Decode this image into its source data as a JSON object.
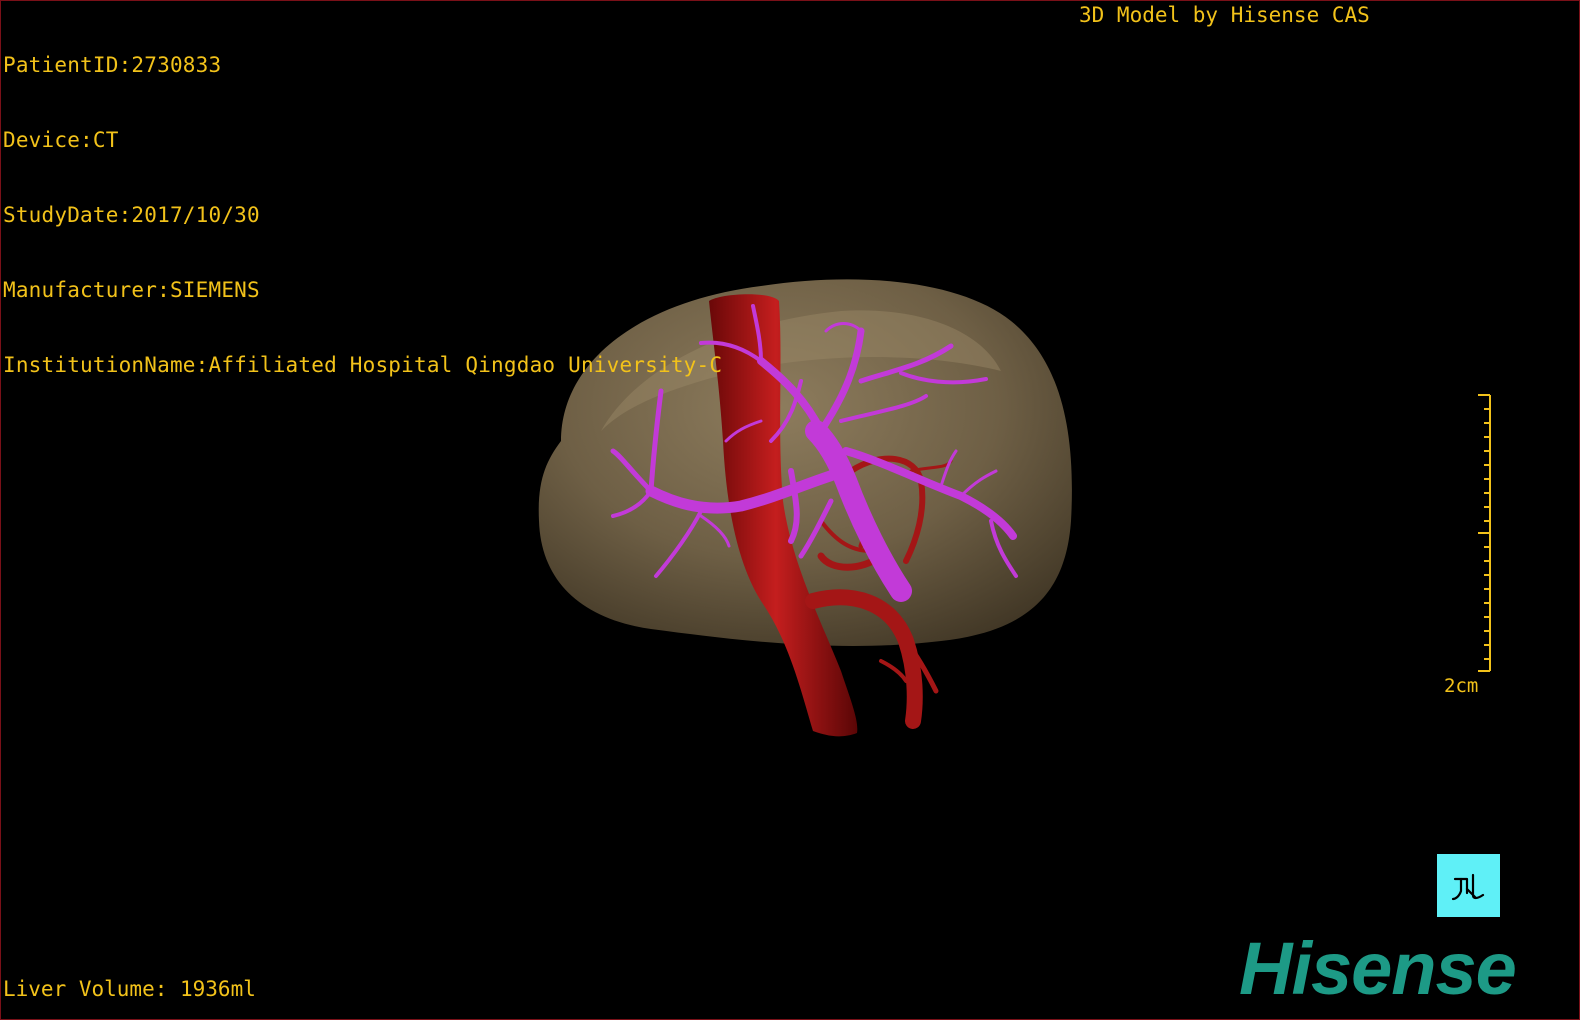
{
  "header": {
    "patient_id": "PatientID:2730833",
    "device": "Device:CT",
    "study_date": "StudyDate:2017/10/30",
    "manufacturer": "Manufacturer:SIEMENS",
    "institution": "InstitutionName:Affiliated Hospital Qingdao University-C",
    "credit": "3D Model by Hisense CAS"
  },
  "footer": {
    "liver_volume": "Liver Volume: 1936ml"
  },
  "scale": {
    "label": "2cm"
  },
  "orientation": {
    "icon": "orientation-cube-icon"
  },
  "brand": {
    "logo_text": "Hisense"
  },
  "colors": {
    "text": "#f2c21a",
    "liver": "#7a6a4e",
    "artery": "#b01818",
    "portal_vein": "#c23ad8",
    "orientation_bg": "#5ff0f7",
    "logo": "#1d9a86"
  }
}
